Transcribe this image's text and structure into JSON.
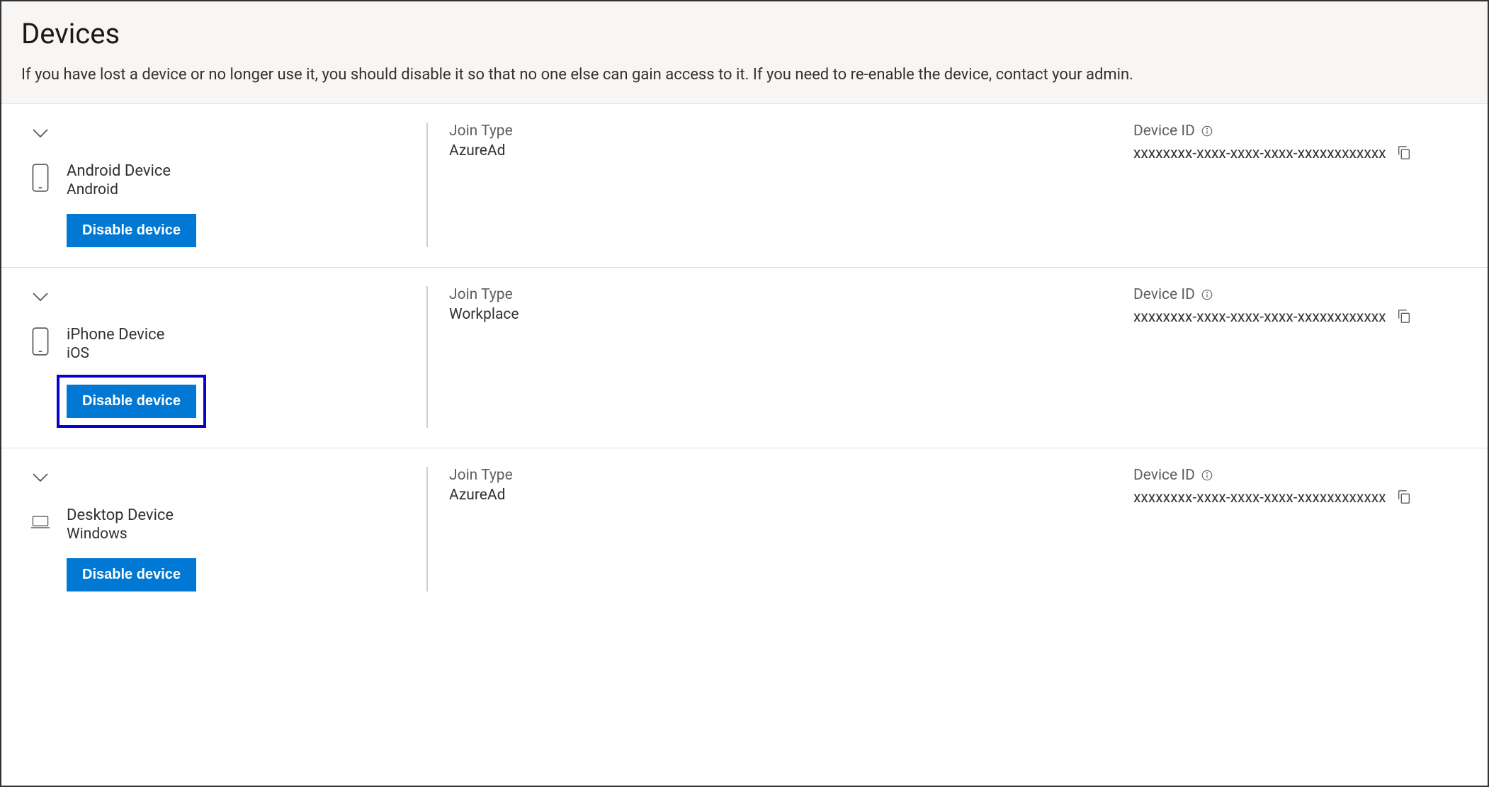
{
  "header": {
    "title": "Devices",
    "description": "If you have lost a device or no longer use it, you should disable it so that no one else can gain access to it. If you need to re-enable the device, contact your admin."
  },
  "labels": {
    "join_type": "Join Type",
    "device_id": "Device ID",
    "disable_button": "Disable device"
  },
  "devices": [
    {
      "name": "Android Device",
      "os": "Android",
      "icon": "phone",
      "join_type": "AzureAd",
      "device_id": "xxxxxxxx-xxxx-xxxx-xxxx-xxxxxxxxxxxx",
      "highlighted": false
    },
    {
      "name": "iPhone Device",
      "os": "iOS",
      "icon": "phone",
      "join_type": "Workplace",
      "device_id": "xxxxxxxx-xxxx-xxxx-xxxx-xxxxxxxxxxxx",
      "highlighted": true
    },
    {
      "name": "Desktop Device",
      "os": "Windows",
      "icon": "laptop",
      "join_type": "AzureAd",
      "device_id": "xxxxxxxx-xxxx-xxxx-xxxx-xxxxxxxxxxxx",
      "highlighted": false
    }
  ]
}
